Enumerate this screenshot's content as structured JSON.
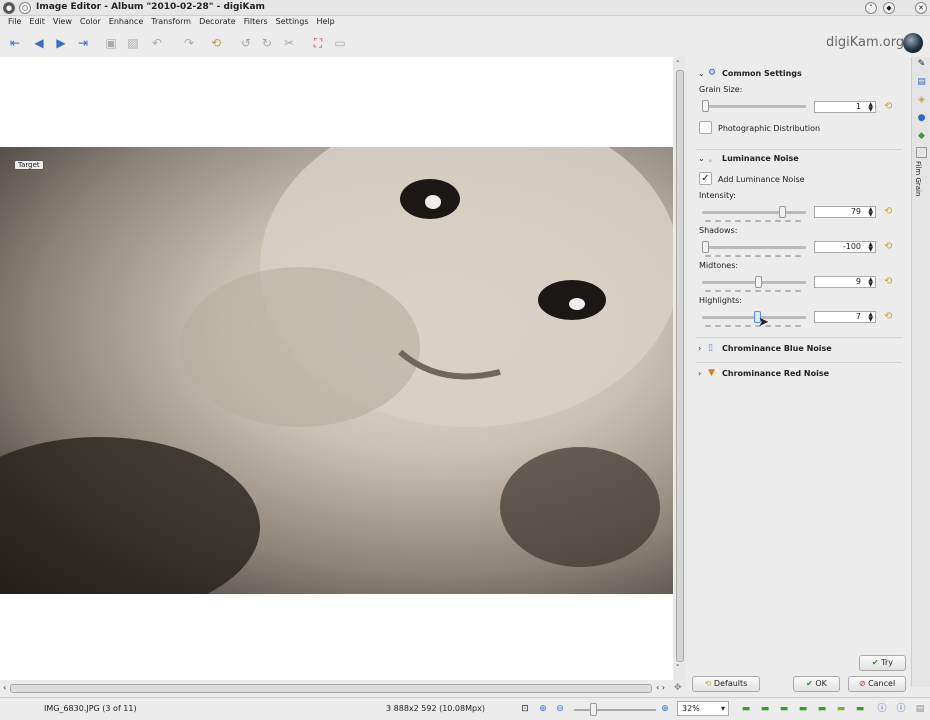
{
  "window": {
    "title": "Image Editor - Album \"2010-02-28\" - digiKam"
  },
  "menu": [
    "File",
    "Edit",
    "View",
    "Color",
    "Enhance",
    "Transform",
    "Decorate",
    "Filters",
    "Settings",
    "Help"
  ],
  "brand": "digiKam.org",
  "canvas": {
    "target_label": "Target"
  },
  "panel": {
    "common": {
      "title": "Common Settings",
      "grain_label": "Grain Size:",
      "grain_value": "1",
      "grain_fraction": 0.0,
      "photo_dist_label": "Photographic Distribution",
      "photo_dist_checked": false
    },
    "luminance": {
      "title": "Luminance Noise",
      "add_label": "Add Luminance Noise",
      "add_checked": true,
      "intensity_label": "Intensity:",
      "intensity_value": "79",
      "intensity_fraction": 0.79,
      "shadows_label": "Shadows:",
      "shadows_value": "-100",
      "shadows_fraction": 0.0,
      "midtones_label": "Midtones:",
      "midtones_value": "9",
      "midtones_fraction": 0.545,
      "highlights_label": "Highlights:",
      "highlights_value": "7",
      "highlights_fraction": 0.535
    },
    "chroma_blue": {
      "title": "Chrominance Blue Noise"
    },
    "chroma_red": {
      "title": "Chrominance Red Noise"
    },
    "side_tab": "Film Grain"
  },
  "buttons": {
    "try": "Try",
    "defaults": "Defaults",
    "ok": "OK",
    "cancel": "Cancel"
  },
  "status": {
    "filename": "IMG_6830.JPG (3 of 11)",
    "dimensions": "3 888x2 592 (10.08Mpx)",
    "zoom": "32%"
  }
}
